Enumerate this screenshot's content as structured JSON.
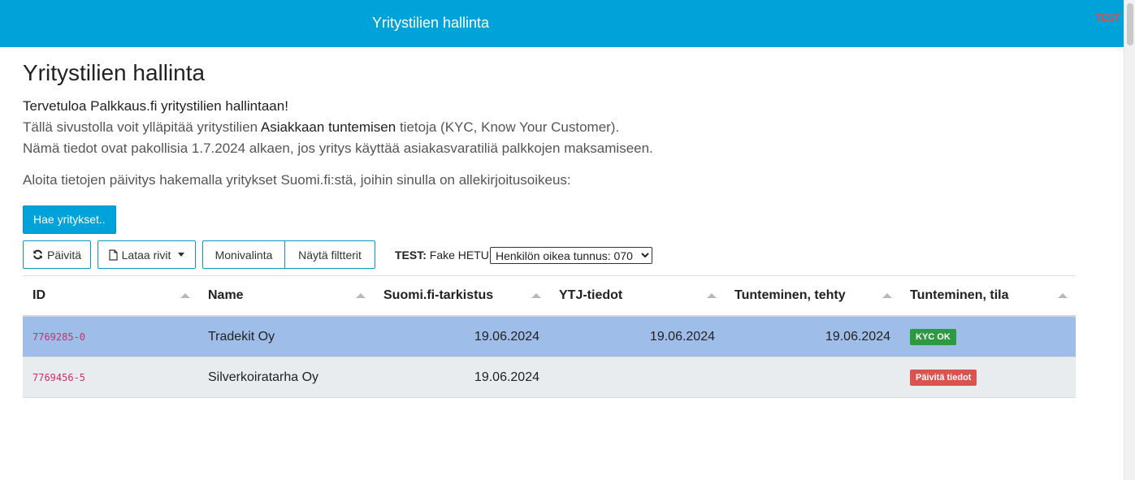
{
  "app": {
    "header_title": "Yritystilien hallinta",
    "environment": "TEST"
  },
  "page": {
    "title": "Yritystilien hallinta",
    "welcome": "Tervetuloa Palkkaus.fi yritystilien hallintaan!",
    "line2_before": "Tällä sivustolla voit ylläpitää yritystilien ",
    "line2_strong": "Asiakkaan tuntemisen",
    "line2_after": " tietoja (KYC, Know Your Customer).",
    "line3": "Nämä tiedot ovat pakollisia 1.7.2024 alkaen, jos yritys käyttää asiakasvaratiliä palkkojen maksamiseen.",
    "start_text": "Aloita tietojen päivitys hakemalla yritykset Suomi.fi:stä, joihin sinulla on allekirjoitusoikeus:",
    "fetch_button": "Hae yritykset.."
  },
  "toolbar": {
    "refresh_label": "Päivitä",
    "refresh_icon": "refresh-icon",
    "load_label": "Lataa rivit",
    "load_icon": "file-icon",
    "multiselect_label": "Monivalinta",
    "filters_label": "Näytä filtterit",
    "test_prefix": "TEST:",
    "fake_hetu_label": "Fake HETU:",
    "hetu_selected": "Henkilön oikea tunnus: 070"
  },
  "table": {
    "columns": [
      "ID",
      "Name",
      "Suomi.fi-tarkistus",
      "YTJ-tiedot",
      "Tunteminen, tehty",
      "Tunteminen, tila"
    ],
    "rows": [
      {
        "id": "7769285-0",
        "name": "Tradekit Oy",
        "suomifi": "19.06.2024",
        "ytj": "19.06.2024",
        "done": "19.06.2024",
        "status": "KYC OK",
        "status_color": "#2e9a3f",
        "selected": true
      },
      {
        "id": "7769456-5",
        "name": "Silverkoiratarha Oy",
        "suomifi": "19.06.2024",
        "ytj": "",
        "done": "",
        "status": "Päivitä tiedot",
        "status_color": "#d9534f",
        "selected": false
      }
    ]
  },
  "colors": {
    "brand": "#00a3d9",
    "env_text": "#e64d3d",
    "selected_row": "#9fbde9",
    "id_text": "#c9306b"
  }
}
